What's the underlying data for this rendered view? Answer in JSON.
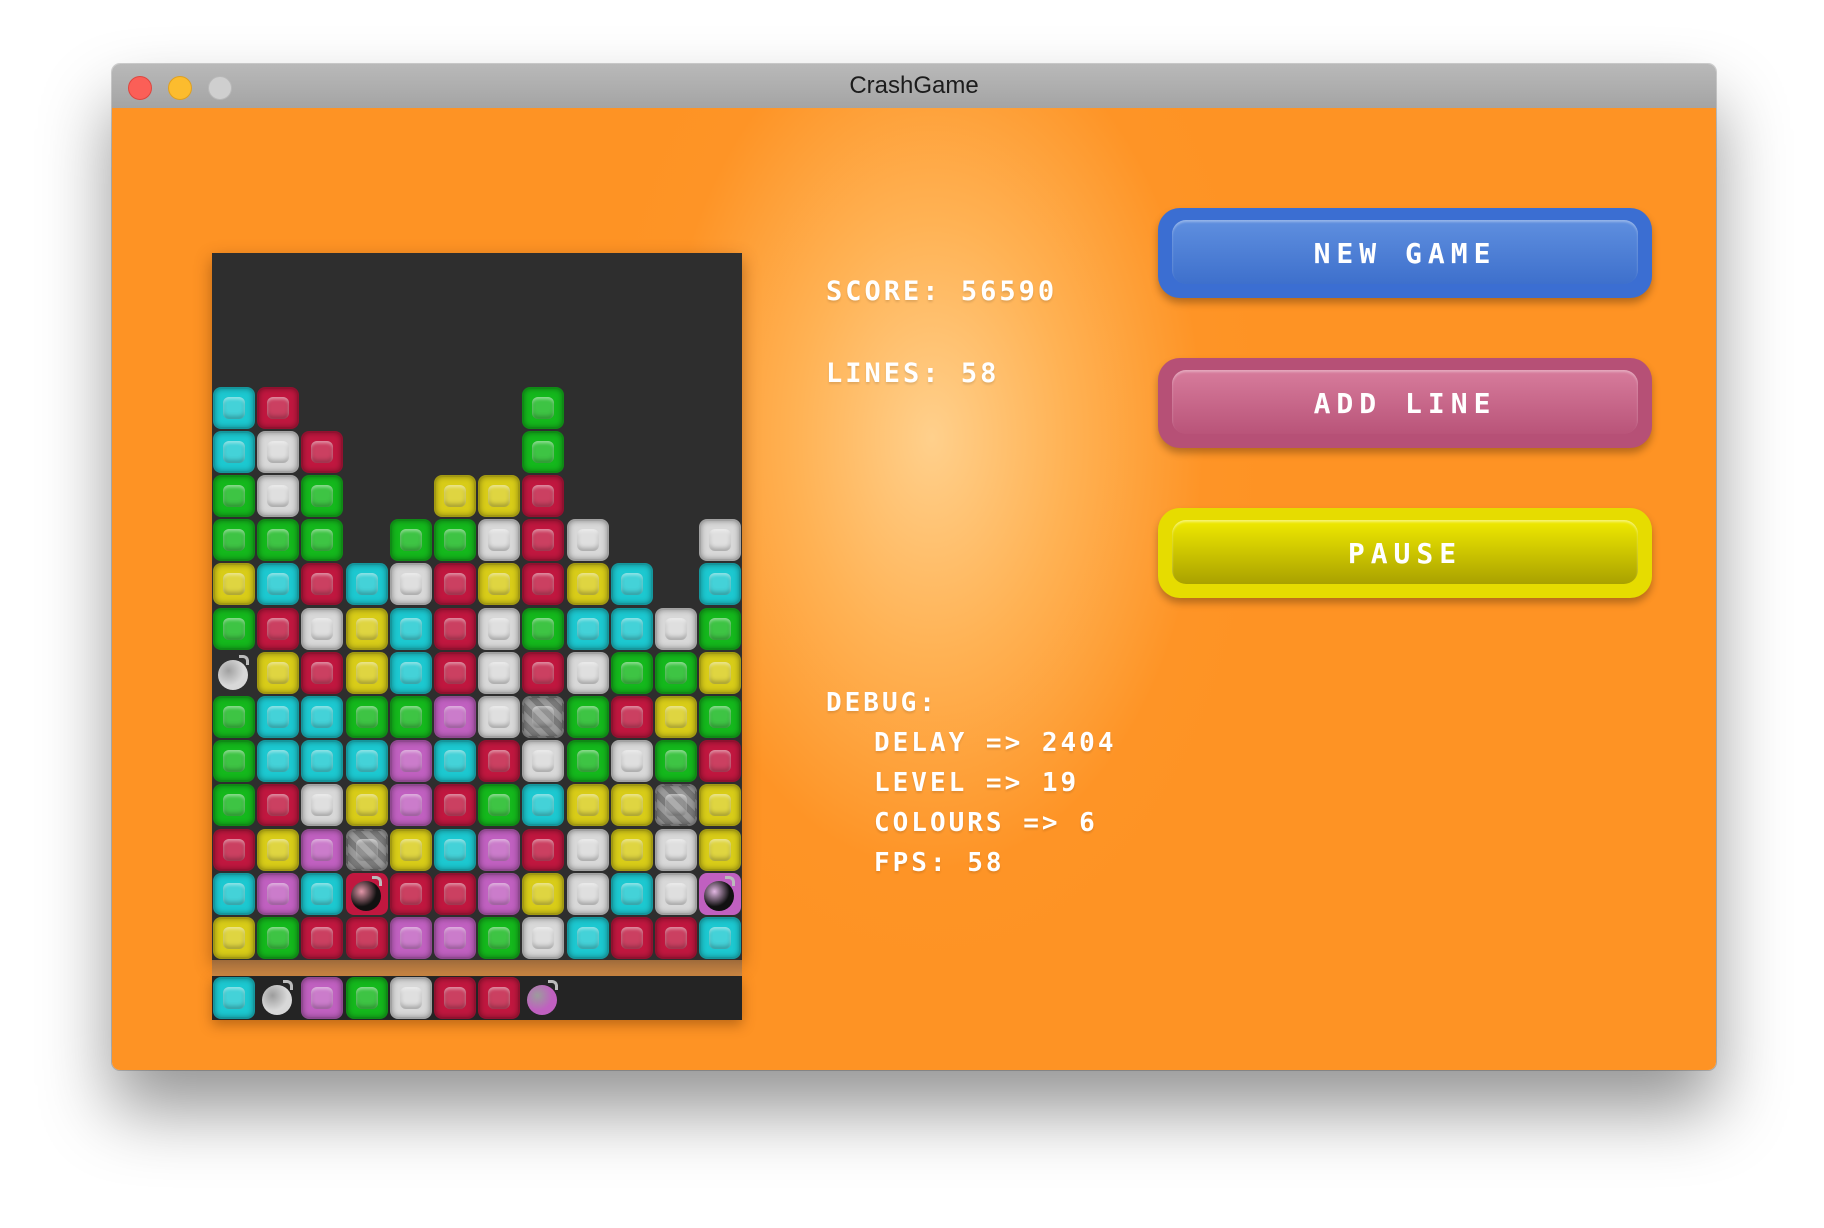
{
  "window": {
    "title": "CrashGame"
  },
  "stats": {
    "score_label": "SCORE:",
    "score": "56590",
    "lines_label": "LINES:",
    "lines": "58"
  },
  "debug": {
    "title": "DEBUG:",
    "delay": "DELAY => 2404",
    "level": "LEVEL => 19",
    "colours": "COLOURS => 6",
    "fps": "FPS: 58"
  },
  "buttons": {
    "new_game": "NEW GAME",
    "add_line": "ADD LINE",
    "pause": "PAUSE"
  },
  "colors": {
    "C": "#1cc8d0",
    "R": "#c0173f",
    "W": "#d8d8d8",
    "G": "#14b81c",
    "Y": "#d8cc18",
    "P": "#c060c0",
    "X": "#8a8a8a",
    "background": "#fe9426",
    "board": "#2e2e2e"
  },
  "board": {
    "rows": [
      "............",
      "............",
      "............",
      "CR.....G....",
      "CWR....G....",
      "GWG..YYR....",
      "GGG.GGWRW..W",
      "YCRCWRYRYC.C",
      "GRWYCRWGCCWG",
      "wYRYCRWRWGGY",
      "GCCGGPWXGRYG",
      "GCCCPCRWGWGR",
      "GRWYPRGCYYXY",
      "RYPXYCPRWYWY",
      "CPCbRRPYWCWb",
      "YGRRPPGWCRRC"
    ],
    "legend": {
      "C": "cyan-block",
      "R": "red-block",
      "W": "white-block",
      "G": "green-block",
      "Y": "yellow-block",
      "P": "purple-block",
      "X": "grey-x-block",
      "w": "white-bomb",
      "b": "black-bomb",
      "p": "purple-bomb"
    }
  },
  "preview": {
    "row": "CwPGWRRp"
  }
}
